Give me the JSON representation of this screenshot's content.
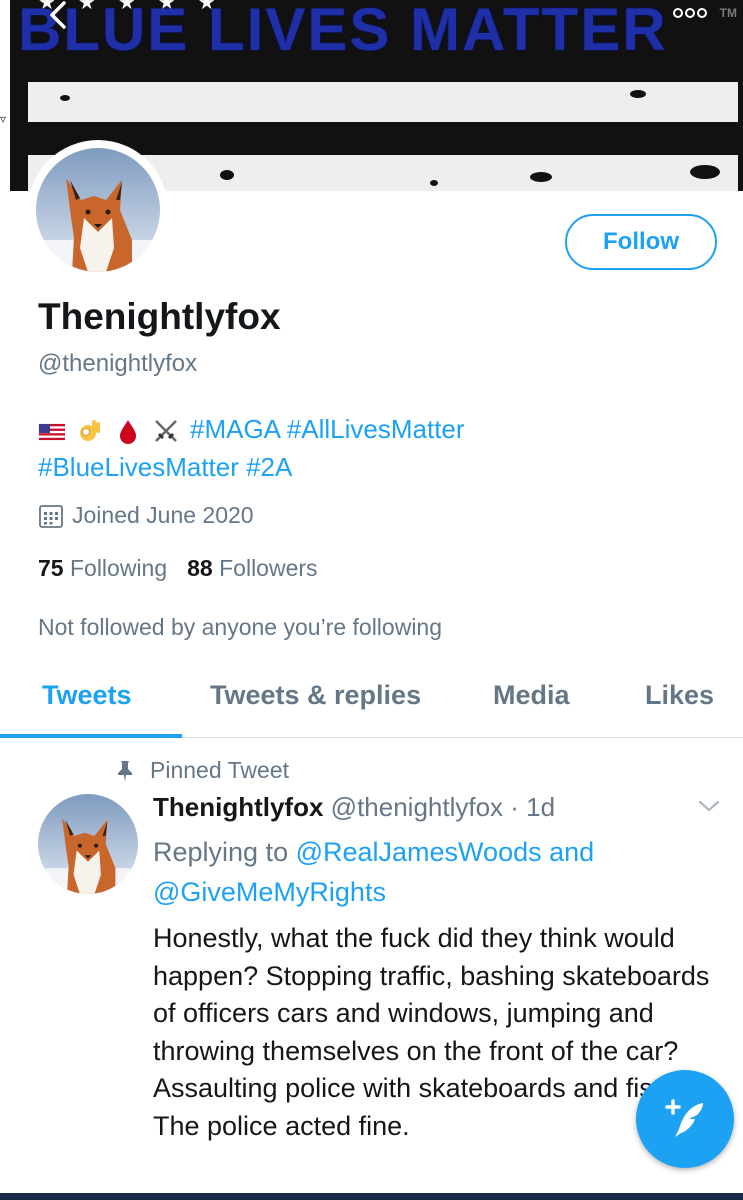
{
  "banner": {
    "title": "BLUE LIVES MATTER",
    "tm": "TM"
  },
  "nav": {
    "back_icon": "chevron-left-icon",
    "more_icon": "more-dots-icon"
  },
  "profile": {
    "follow_label": "Follow",
    "display_name": "Thenightlyfox",
    "handle": "@thenightlyfox",
    "bio_emojis": [
      "us-flag-icon",
      "ok-hand-icon",
      "blood-drop-icon",
      "crossed-swords-icon"
    ],
    "bio_line1": "#MAGA #AllLivesMatter",
    "bio_line2": "#BlueLivesMatter #2A",
    "joined": "Joined June 2020",
    "following_count": "75",
    "following_label": "Following",
    "followers_count": "88",
    "followers_label": "Followers",
    "not_followed": "Not followed by anyone you’re following"
  },
  "tabs": [
    {
      "label": "Tweets",
      "active": true
    },
    {
      "label": "Tweets & replies",
      "active": false
    },
    {
      "label": "Media",
      "active": false
    },
    {
      "label": "Likes",
      "active": false
    }
  ],
  "tweet": {
    "pinned_label": "Pinned Tweet",
    "name": "Thenightlyfox",
    "meta": "@thenightlyfox · 1d",
    "replying_prefix": "Replying to ",
    "mention1": "@RealJamesWoods",
    "and": " and",
    "mention2": "@GiveMeMyRights",
    "text": "Honestly, what the fuck did they think would happen? Stopping traffic, bashing skateboards of officers cars and windows, jumping and throwing themselves on the front of the car? Assaulting police with skateboards and fists? The police acted fine."
  },
  "fab": {
    "icon": "compose-tweet-icon"
  },
  "colors": {
    "accent": "#1da1f2",
    "muted": "#657786",
    "text": "#14171a",
    "banner_title": "#1f2fa8"
  }
}
